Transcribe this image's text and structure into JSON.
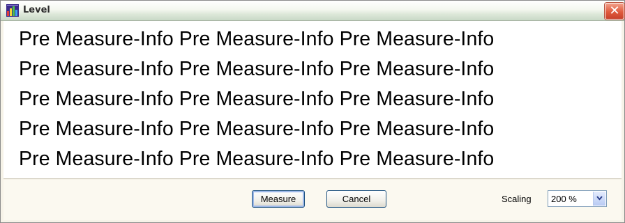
{
  "window": {
    "title": "Level",
    "close_symbol": "✕",
    "icon": "level-app-icon"
  },
  "content": {
    "lines": [
      "Pre Measure-Info Pre Measure-Info Pre Measure-Info",
      "Pre Measure-Info Pre Measure-Info Pre Measure-Info",
      "Pre Measure-Info Pre Measure-Info Pre Measure-Info",
      "Pre Measure-Info Pre Measure-Info Pre Measure-Info",
      "Pre Measure-Info Pre Measure-Info Pre Measure-Info"
    ]
  },
  "footer": {
    "measure_label": "Measure",
    "cancel_label": "Cancel",
    "scaling_label": "Scaling",
    "scaling_value": "200 %"
  },
  "colors": {
    "close_button": "#E05A3D",
    "focus_ring": "#9DB8E8",
    "button_border": "#1C5180"
  }
}
